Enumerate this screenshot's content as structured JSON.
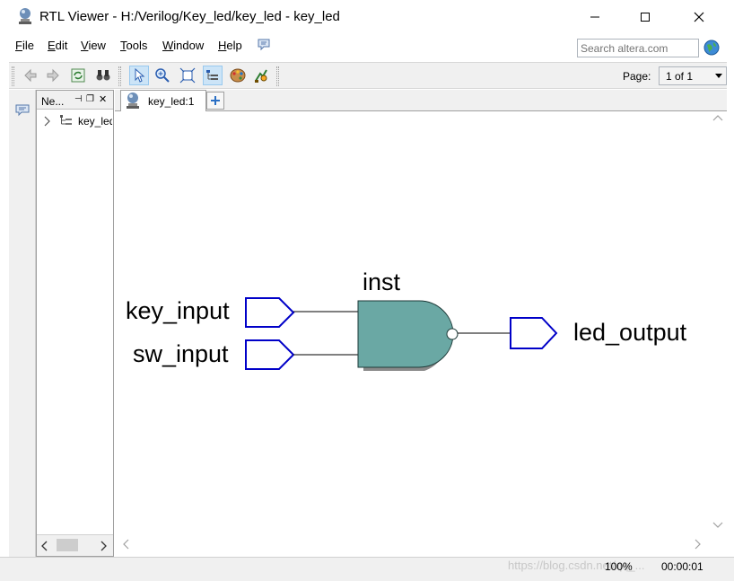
{
  "window": {
    "title": "RTL Viewer - H:/Verilog/Key_led/key_led - key_led"
  },
  "menu": {
    "items": [
      {
        "label": "File",
        "mnemonic": "F",
        "rest": "ile"
      },
      {
        "label": "Edit",
        "mnemonic": "E",
        "rest": "dit"
      },
      {
        "label": "View",
        "mnemonic": "V",
        "rest": "iew"
      },
      {
        "label": "Tools",
        "mnemonic": "T",
        "rest": "ools"
      },
      {
        "label": "Window",
        "mnemonic": "W",
        "rest": "indow"
      },
      {
        "label": "Help",
        "mnemonic": "H",
        "rest": "elp"
      }
    ],
    "search_placeholder": "Search altera.com"
  },
  "toolbar": {
    "page_label": "Page:",
    "page_value": "1 of 1"
  },
  "navigator": {
    "title": "Ne...",
    "tree_item": "key_led"
  },
  "tab": {
    "label": "key_led:1"
  },
  "schematic": {
    "instance_name": "inst",
    "inputs": [
      "key_input",
      "sw_input"
    ],
    "output": "led_output",
    "gate_color": "#6aa8a4",
    "pin_color": "#0000c8"
  },
  "status": {
    "zoom": "100%",
    "time": "00:00:01",
    "watermark": "https://blog.csdn.net/qq_..."
  }
}
